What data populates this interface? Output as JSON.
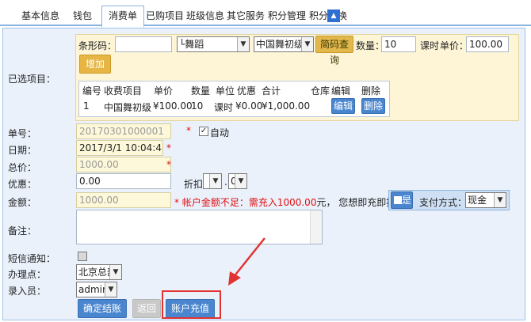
{
  "tabs": [
    {
      "label": "基本信息"
    },
    {
      "label": "钱包"
    },
    {
      "label": "消费单"
    },
    {
      "label": "已购项目"
    },
    {
      "label": "班级信息"
    },
    {
      "label": "其它服务"
    },
    {
      "label": "积分管理"
    },
    {
      "label": "积分兑换"
    }
  ],
  "selected": {
    "label": "已选项目：",
    "barcode_label": "条形码：",
    "barcode_value": "",
    "category_select": "└舞蹈",
    "course_select": "中国舞初级",
    "barcode_query_button": "简码查询",
    "quantity_label": "数量：",
    "quantity_value": "10",
    "unit_label": "课时",
    "price_label": "单价：",
    "price_value": "100.00",
    "add_button": "增加",
    "table": {
      "headers": [
        "编号",
        "收费项目",
        "单价",
        "数量",
        "单位",
        "优惠",
        "合计",
        "仓库",
        "编辑",
        "删除"
      ],
      "rows": [
        {
          "no": "1",
          "item": "中国舞初级",
          "price": "¥100.00",
          "qty": "10",
          "unit": "课时",
          "discount": "¥0.00",
          "total": "¥1,000.00",
          "warehouse": "",
          "edit": "编辑",
          "delete": "删除"
        }
      ]
    }
  },
  "order_no": {
    "label": "单号：",
    "value": "20170301000001",
    "auto_label": "自动"
  },
  "date": {
    "label": "日期：",
    "value": "2017/3/1 10:04:47"
  },
  "total_price": {
    "label": "总价：",
    "value": "1000.00"
  },
  "discount": {
    "label": "优惠：",
    "value": "0.00",
    "rate_label": "折扣：",
    "rate_int": "",
    "rate_dot": ".",
    "rate_dec": "0"
  },
  "amount": {
    "label": "金额：",
    "value": "1000.00",
    "notice_prefix": "* 帐户金额不足：需充入",
    "notice_amount": "1000.00",
    "notice_suffix": "元， 您想即充即扣？",
    "yes_label": "是",
    "pay_method_label": "支付方式：",
    "pay_method_value": "现金"
  },
  "remark": {
    "label": "备注：",
    "value": ""
  },
  "sms": {
    "label": "短信通知："
  },
  "branch": {
    "label": "办理点：",
    "value": "北京总部"
  },
  "operator": {
    "label": "录入员：",
    "value": "admin"
  },
  "buttons": {
    "confirm": "确定结账",
    "back": "返回",
    "recharge": "账户充值"
  },
  "required_mark": "*",
  "colors": {
    "accent": "#4a86cf",
    "highlight": "#e23333",
    "amount_red": "#e01010"
  }
}
